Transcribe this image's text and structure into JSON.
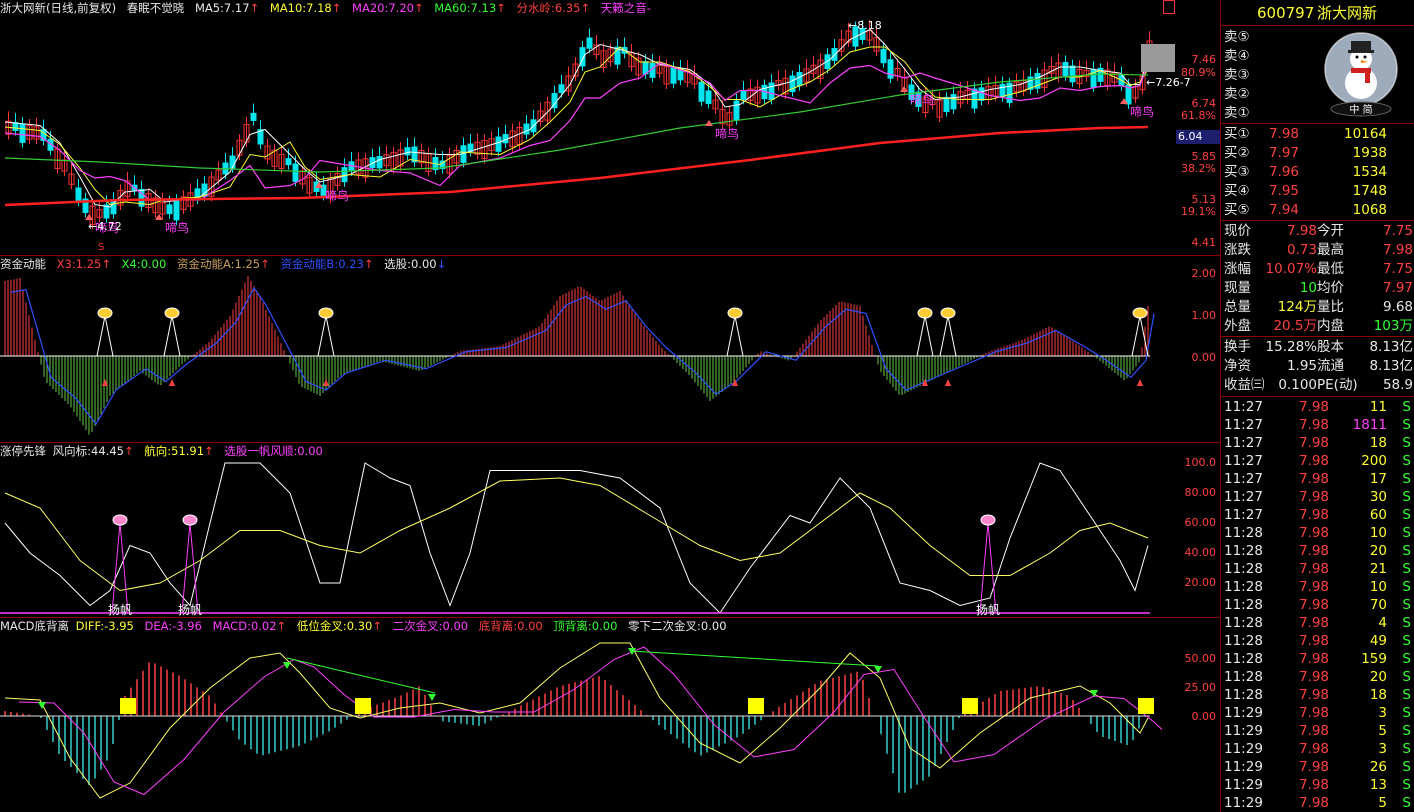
{
  "header_main": {
    "title": "浙大网新(日线,前复权)",
    "indicator": "春眠不觉晓",
    "ma5": "MA5:7.17",
    "ma10": "MA10:7.18",
    "ma20": "MA20:7.20",
    "ma60": "MA60:7.13",
    "fsl": "分水岭:6.35",
    "tl": "天籁之音-"
  },
  "main_axis": [
    "7.46",
    "80.9%",
    "6.74",
    "61.8%",
    "6.04",
    "5.85",
    "38.2%",
    "5.13",
    "19.1%",
    "4.41"
  ],
  "main_labels": {
    "high": "8.18",
    "low": "4.72",
    "bird": "啼鸟",
    "cur": "7.26-7",
    "s": "S"
  },
  "header_p2": {
    "title": "资金动能",
    "x3": "X3:1.25",
    "x4": "X4:0.00",
    "a": "资金动能A:1.25",
    "b": "资金动能B:0.23",
    "xg": "选股:0.00"
  },
  "p2_axis": [
    "2.00",
    "1.00",
    "0.00"
  ],
  "header_p3": {
    "title": "涨停先锋",
    "fxb": "风向标:44.45",
    "hx": "航向:51.91",
    "xg": "选股一帆风顺:0.00"
  },
  "p3_axis": [
    "100.0",
    "80.00",
    "60.00",
    "40.00",
    "20.00"
  ],
  "p3_label": "扬帆",
  "header_p4": {
    "title": "MACD底背离",
    "diff": "DIFF:-3.95",
    "dea": "DEA:-3.96",
    "macd": "MACD:0.02",
    "dw": "低位金叉:0.30",
    "ec": "二次金叉:0.00",
    "dbl": "底背离:0.00",
    "dingbl": "顶背离:0.00",
    "lx": "零下二次金叉:0.00"
  },
  "p4_axis": [
    "50.00",
    "25.00",
    "0.00"
  ],
  "stock": {
    "code": "600797",
    "name": "浙大网新",
    "snow_label": "中  简"
  },
  "sell": [
    {
      "label": "卖⑤"
    },
    {
      "label": "卖④"
    },
    {
      "label": "卖③"
    },
    {
      "label": "卖②"
    },
    {
      "label": "卖①"
    }
  ],
  "buy": [
    {
      "label": "买①",
      "price": "7.98",
      "vol": "10164"
    },
    {
      "label": "买②",
      "price": "7.97",
      "vol": "1938"
    },
    {
      "label": "买③",
      "price": "7.96",
      "vol": "1534"
    },
    {
      "label": "买④",
      "price": "7.95",
      "vol": "1748"
    },
    {
      "label": "买⑤",
      "price": "7.94",
      "vol": "1068"
    }
  ],
  "quote": [
    {
      "l1": "现价",
      "v1": "7.98",
      "l2": "今开",
      "v2": "7.75",
      "c1": "red",
      "c2": "red"
    },
    {
      "l1": "涨跌",
      "v1": "0.73",
      "l2": "最高",
      "v2": "7.98",
      "c1": "red",
      "c2": "red"
    },
    {
      "l1": "涨幅",
      "v1": "10.07%",
      "l2": "最低",
      "v2": "7.75",
      "c1": "red",
      "c2": "red"
    },
    {
      "l1": "现量",
      "v1": "10",
      "l2": "均价",
      "v2": "7.97",
      "c1": "grn",
      "c2": "red"
    },
    {
      "l1": "总量",
      "v1": "124万",
      "l2": "量比",
      "v2": "9.68",
      "c1": "yel",
      "c2": "wht"
    },
    {
      "l1": "外盘",
      "v1": "20.5万",
      "l2": "内盘",
      "v2": "103万",
      "c1": "red",
      "c2": "grn"
    }
  ],
  "quote2": [
    {
      "l1": "换手",
      "v1": "15.28%",
      "l2": "股本",
      "v2": "8.13亿"
    },
    {
      "l1": "净资",
      "v1": "1.95",
      "l2": "流通",
      "v2": "8.13亿"
    },
    {
      "l1": "收益㈢",
      "v1": "0.100",
      "l2": "PE(动)",
      "v2": "58.9"
    }
  ],
  "ticks": [
    {
      "t": "11:27",
      "p": "7.98",
      "v": "11",
      "s": "S",
      "vc": "yel"
    },
    {
      "t": "11:27",
      "p": "7.98",
      "v": "1811",
      "s": "S",
      "vc": "mag"
    },
    {
      "t": "11:27",
      "p": "7.98",
      "v": "18",
      "s": "S",
      "vc": "yel"
    },
    {
      "t": "11:27",
      "p": "7.98",
      "v": "200",
      "s": "S",
      "vc": "yel"
    },
    {
      "t": "11:27",
      "p": "7.98",
      "v": "17",
      "s": "S",
      "vc": "yel"
    },
    {
      "t": "11:27",
      "p": "7.98",
      "v": "30",
      "s": "S",
      "vc": "yel"
    },
    {
      "t": "11:27",
      "p": "7.98",
      "v": "60",
      "s": "S",
      "vc": "yel"
    },
    {
      "t": "11:28",
      "p": "7.98",
      "v": "10",
      "s": "S",
      "vc": "yel"
    },
    {
      "t": "11:28",
      "p": "7.98",
      "v": "20",
      "s": "S",
      "vc": "yel"
    },
    {
      "t": "11:28",
      "p": "7.98",
      "v": "21",
      "s": "S",
      "vc": "yel"
    },
    {
      "t": "11:28",
      "p": "7.98",
      "v": "10",
      "s": "S",
      "vc": "yel"
    },
    {
      "t": "11:28",
      "p": "7.98",
      "v": "70",
      "s": "S",
      "vc": "yel"
    },
    {
      "t": "11:28",
      "p": "7.98",
      "v": "4",
      "s": "S",
      "vc": "yel"
    },
    {
      "t": "11:28",
      "p": "7.98",
      "v": "49",
      "s": "S",
      "vc": "yel"
    },
    {
      "t": "11:28",
      "p": "7.98",
      "v": "159",
      "s": "S",
      "vc": "yel"
    },
    {
      "t": "11:28",
      "p": "7.98",
      "v": "20",
      "s": "S",
      "vc": "yel"
    },
    {
      "t": "11:28",
      "p": "7.98",
      "v": "18",
      "s": "S",
      "vc": "yel"
    },
    {
      "t": "11:29",
      "p": "7.98",
      "v": "3",
      "s": "S",
      "vc": "yel"
    },
    {
      "t": "11:29",
      "p": "7.98",
      "v": "5",
      "s": "S",
      "vc": "yel"
    },
    {
      "t": "11:29",
      "p": "7.98",
      "v": "3",
      "s": "S",
      "vc": "yel"
    },
    {
      "t": "11:29",
      "p": "7.98",
      "v": "26",
      "s": "S",
      "vc": "yel"
    },
    {
      "t": "11:29",
      "p": "7.98",
      "v": "13",
      "s": "S",
      "vc": "yel"
    },
    {
      "t": "11:29",
      "p": "7.98",
      "v": "5",
      "s": "S",
      "vc": "yel"
    }
  ],
  "colors": {
    "up": "#ff3333",
    "down": "#00e5ee",
    "ma5": "#ffffff",
    "ma10": "#ffff33",
    "ma20": "#ff40ff",
    "ma60": "#33cc33",
    "fsl": "#ff2020",
    "grid": "#8b0000"
  }
}
